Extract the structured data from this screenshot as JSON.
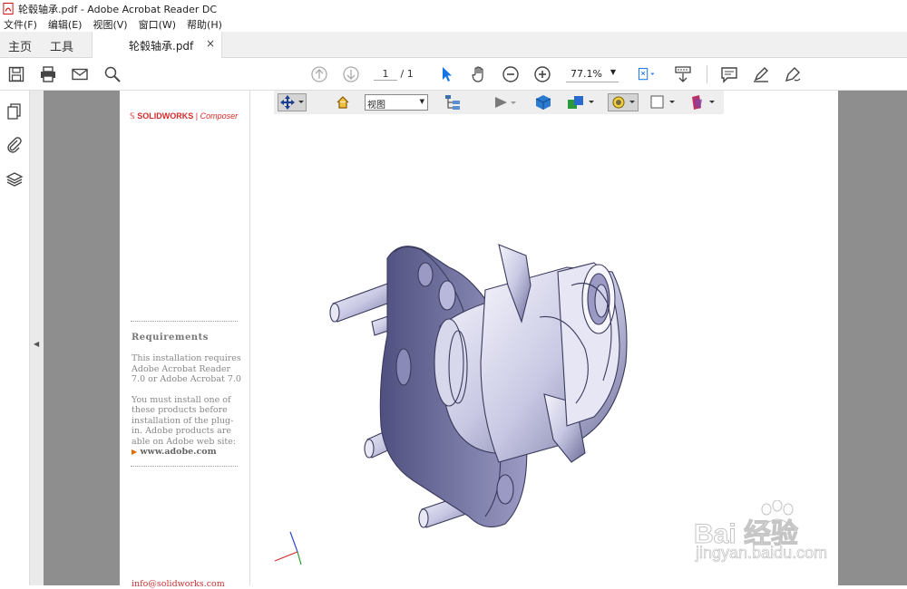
{
  "window": {
    "title": "轮毂轴承.pdf - Adobe Acrobat Reader DC"
  },
  "menu": [
    "文件(F)",
    "编辑(E)",
    "视图(V)",
    "窗口(W)",
    "帮助(H)"
  ],
  "tabs": {
    "home": "主页",
    "tools": "工具",
    "document": "轮毂轴承.pdf",
    "close": "×"
  },
  "pager": {
    "current": "1",
    "total": "/ 1"
  },
  "zoom": {
    "value": "77.1%"
  },
  "viewer3d": {
    "view_select": "视图"
  },
  "sidepanel": {
    "logo_brand": "SOLIDWORKS",
    "logo_product": "Composer",
    "requirements_title": "Requirements",
    "req_para1": "This installation requires Adobe Acrobat Reader 7.0 or Adobe Acrobat 7.0",
    "req_para2": "You must install one of these products before installation of the plug-in. Adobe products are able on Adobe web site:",
    "adobe_link": "www.adobe.com",
    "contact": "info@solidworks.com"
  },
  "watermark": {
    "brand": "Bai  经验",
    "url": "jingyan.baidu.com"
  },
  "colors": {
    "accent_blue": "#1473e6",
    "solidworks_red": "#d42a2a",
    "part_fill": "#c9c9e6"
  }
}
